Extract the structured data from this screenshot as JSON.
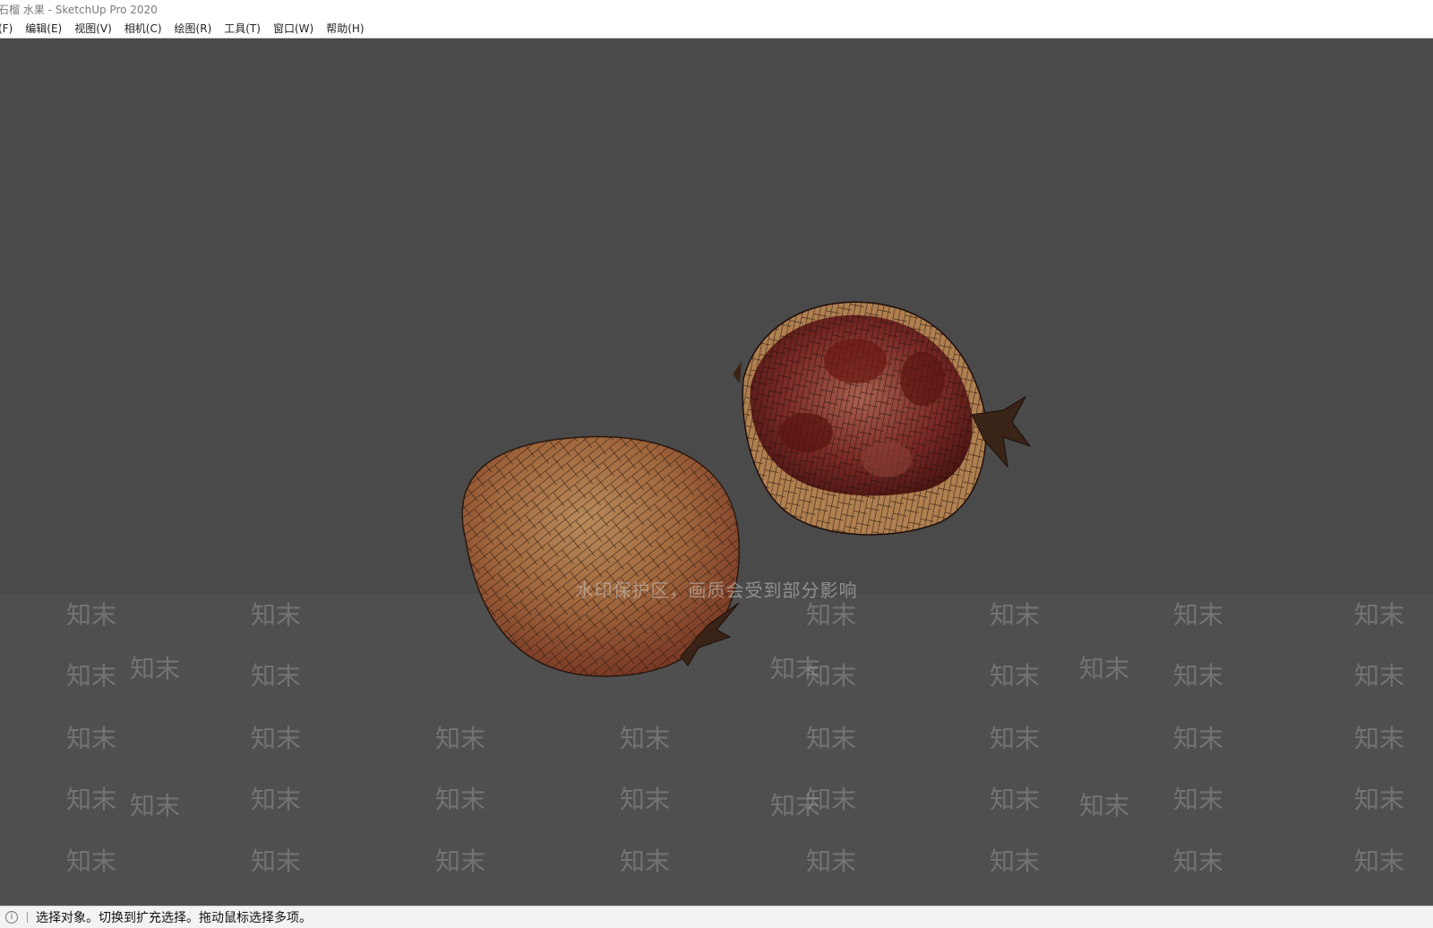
{
  "window": {
    "title": "石榴 水果 - SketchUp Pro 2020"
  },
  "menu": {
    "items": [
      {
        "label": "(F)"
      },
      {
        "label": "编辑(E)"
      },
      {
        "label": "视图(V)"
      },
      {
        "label": "相机(C)"
      },
      {
        "label": "绘图(R)"
      },
      {
        "label": "工具(T)"
      },
      {
        "label": "窗口(W)"
      },
      {
        "label": "帮助(H)"
      }
    ]
  },
  "viewport": {
    "background_color": "#4a4a4a",
    "watermark_notice": "水印保护区，画质会受到部分影响",
    "watermark_text": "知末"
  },
  "statusbar": {
    "info_icon": "info-icon",
    "message": "选择对象。切换到扩充选择。拖动鼠标选择多项。"
  }
}
